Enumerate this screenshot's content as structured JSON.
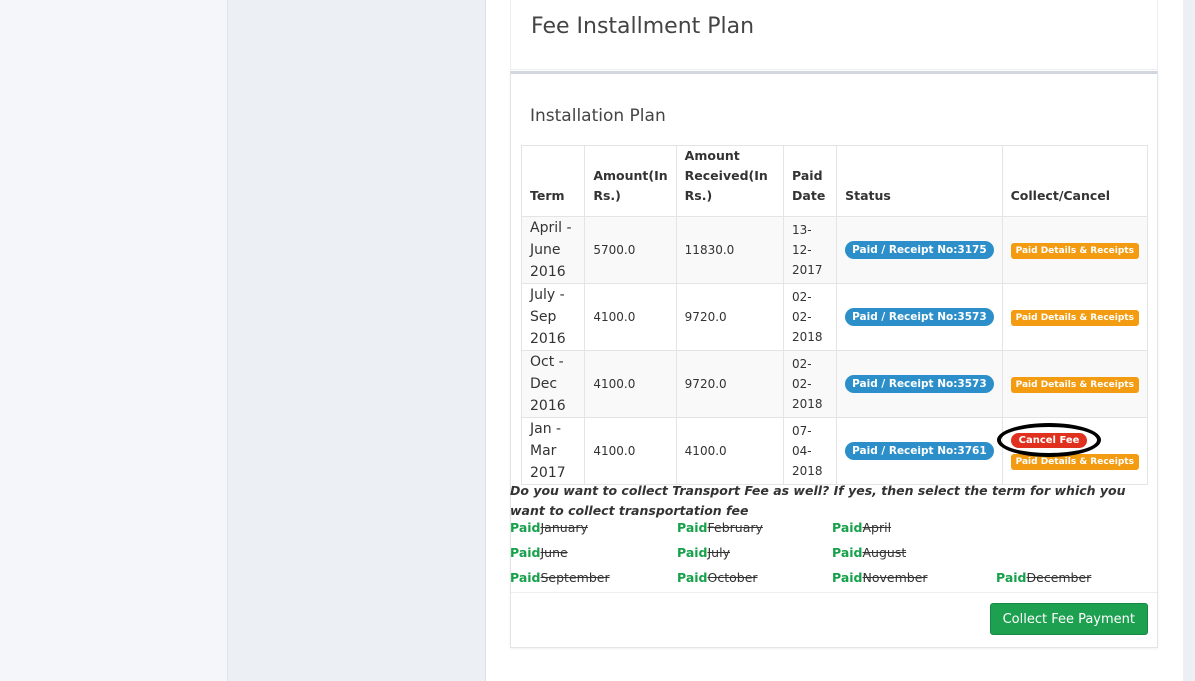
{
  "page": {
    "title": "Fee Installment Plan"
  },
  "plan": {
    "section_title": "Installation Plan",
    "headers": {
      "term": "Term",
      "amount": "Amount(In Rs.)",
      "received": "Amount Received(In Rs.)",
      "paid_date": "Paid Date",
      "status": "Status",
      "collect": "Collect/Cancel"
    },
    "rows": [
      {
        "term": "April - June 2016",
        "amount": "5700.0",
        "received": "11830.0",
        "paid_date": "13-12-2017",
        "status": "Paid / Receipt No:3175",
        "details_label": "Paid Details & Receipts"
      },
      {
        "term": "July - Sep 2016",
        "amount": "4100.0",
        "received": "9720.0",
        "paid_date": "02-02-2018",
        "status": "Paid / Receipt No:3573",
        "details_label": "Paid Details & Receipts"
      },
      {
        "term": "Oct - Dec 2016",
        "amount": "4100.0",
        "received": "9720.0",
        "paid_date": "02-02-2018",
        "status": "Paid / Receipt No:3573",
        "details_label": "Paid Details & Receipts"
      },
      {
        "term": "Jan - Mar 2017",
        "amount": "4100.0",
        "received": "4100.0",
        "paid_date": "07-04-2018",
        "status": "Paid / Receipt No:3761",
        "cancel_label": "Cancel Fee",
        "details_label": "Paid Details & Receipts"
      }
    ]
  },
  "transport": {
    "question": "Do you want to collect Transport Fee as well? If yes, then select the term for which you want to collect transportation fee",
    "paid_label": "Paid",
    "months": [
      "January",
      "February",
      "April",
      "June",
      "July",
      "August",
      "September",
      "October",
      "November",
      "December"
    ]
  },
  "footer": {
    "collect_button": "Collect Fee Payment"
  },
  "colors": {
    "status_badge": "#2c8fc9",
    "details_button": "#f39c12",
    "cancel_button": "#e0311f",
    "paid_text": "#16a14a",
    "collect_button": "#1ea051"
  }
}
